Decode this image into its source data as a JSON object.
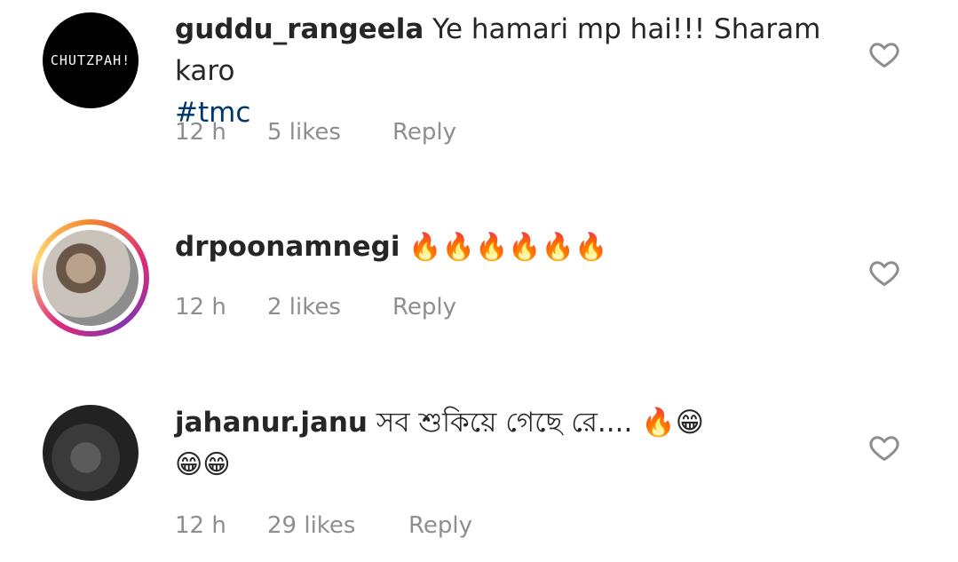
{
  "comments": [
    {
      "username": "guddu_rangeela",
      "text": "Ye hamari mp hai!!! Sharam karo",
      "hashtag": "#tmc",
      "avatar_text": "CHUTZPAH!",
      "time": "12 h",
      "likes": "5 likes",
      "reply": "Reply"
    },
    {
      "username": "drpoonamnegi",
      "text": "🔥🔥🔥🔥🔥🔥",
      "time": "12 h",
      "likes": "2 likes",
      "reply": "Reply"
    },
    {
      "username": "jahanur.janu",
      "text": "সব শুকিয়ে গেছে রে.... 🔥😁",
      "text2": "😁😁",
      "time": "12 h",
      "likes": "29 likes",
      "reply": "Reply"
    }
  ],
  "icons": {
    "like": "heart-outline-icon"
  },
  "colors": {
    "text": "#262626",
    "meta": "#8e8e8e",
    "hashtag": "#00376b"
  }
}
